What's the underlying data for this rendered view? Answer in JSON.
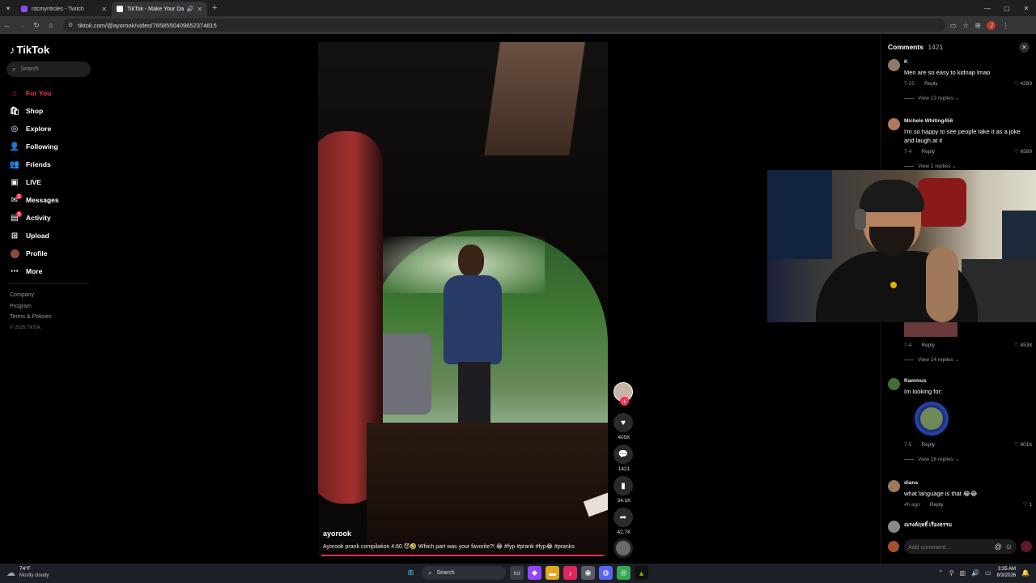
{
  "browser": {
    "tabs": [
      {
        "title": "rdcmyriticles - Twitch",
        "color": "#9146ff",
        "active": false
      },
      {
        "title": "TikTok - Make Your Day",
        "color": "#ffffff",
        "active": true
      }
    ],
    "url": "tiktok.com/@ayorook/video/7658550409652374815",
    "profile_initial": "J"
  },
  "sidebar": {
    "logo": "TikTok",
    "search_placeholder": "Search",
    "items": [
      {
        "label": "For You",
        "icon": "home-icon",
        "active": true
      },
      {
        "label": "Shop",
        "icon": "shop-icon"
      },
      {
        "label": "Explore",
        "icon": "compass-icon"
      },
      {
        "label": "Following",
        "icon": "following-icon"
      },
      {
        "label": "Friends",
        "icon": "friends-icon"
      },
      {
        "label": "LIVE",
        "icon": "live-icon"
      },
      {
        "label": "Messages",
        "icon": "messages-icon",
        "badge": "1"
      },
      {
        "label": "Activity",
        "icon": "activity-icon",
        "badge": "1"
      },
      {
        "label": "Upload",
        "icon": "upload-icon"
      },
      {
        "label": "Profile",
        "icon": "avatar"
      },
      {
        "label": "More",
        "icon": "more-icon"
      }
    ],
    "footer": [
      "Company",
      "Program",
      "Terms & Policies"
    ],
    "copyright": "© 2026 TikTok"
  },
  "video": {
    "author": "ayorook",
    "description": "Ayorook prank compilation 4:60 😈🤣 Which part was your favorite?! 😂 #fyp #prank #fyp😂 #pranks",
    "progress": 0.99,
    "actions": {
      "likes": "405K",
      "comments": "1421",
      "saves": "34.1K",
      "shares": "42.7K"
    }
  },
  "comments": {
    "title": "Comments",
    "count": "1421",
    "list": [
      {
        "user": "K",
        "text": "Men are so easy to kidnap lmao",
        "time": "7-25",
        "reply": "Reply",
        "likes": "4289",
        "view_replies": "View 13 replies",
        "avatar_color": "#8a7a6a"
      },
      {
        "user": "Michele Whiting456",
        "text": "I'm so happy to see people take it as a joke and laugh at it",
        "time": "7-4",
        "reply": "Reply",
        "likes": "6589",
        "view_replies": "View 1 replies",
        "avatar_color": "#b07a5a"
      },
      {
        "user": "",
        "text": "",
        "time": "7-4",
        "reply": "Reply",
        "likes": "4538",
        "view_replies": "View 14 replies",
        "avatar_color": "#6a3a3a"
      },
      {
        "user": "Rammus",
        "text": "Im looking for:",
        "time": "7-5",
        "reply": "Reply",
        "likes": "9016",
        "view_replies": "View 16 replies",
        "avatar_color": "#4a6a3a"
      },
      {
        "user": "diana",
        "text": "what language is that 😂😂",
        "time": "4h ago",
        "reply": "Reply",
        "likes": "1",
        "avatar_color": "#9a7a5a"
      },
      {
        "user": "ณรงค์ฤทธิ์ เรืองธรรม",
        "avatar_color": "#888888"
      }
    ],
    "input_placeholder": "Add comment..."
  },
  "taskbar": {
    "weather_temp": "74°F",
    "weather_desc": "Mostly cloudy",
    "search_label": "Search",
    "time": "3:35 AM",
    "date": "8/3/2026"
  }
}
